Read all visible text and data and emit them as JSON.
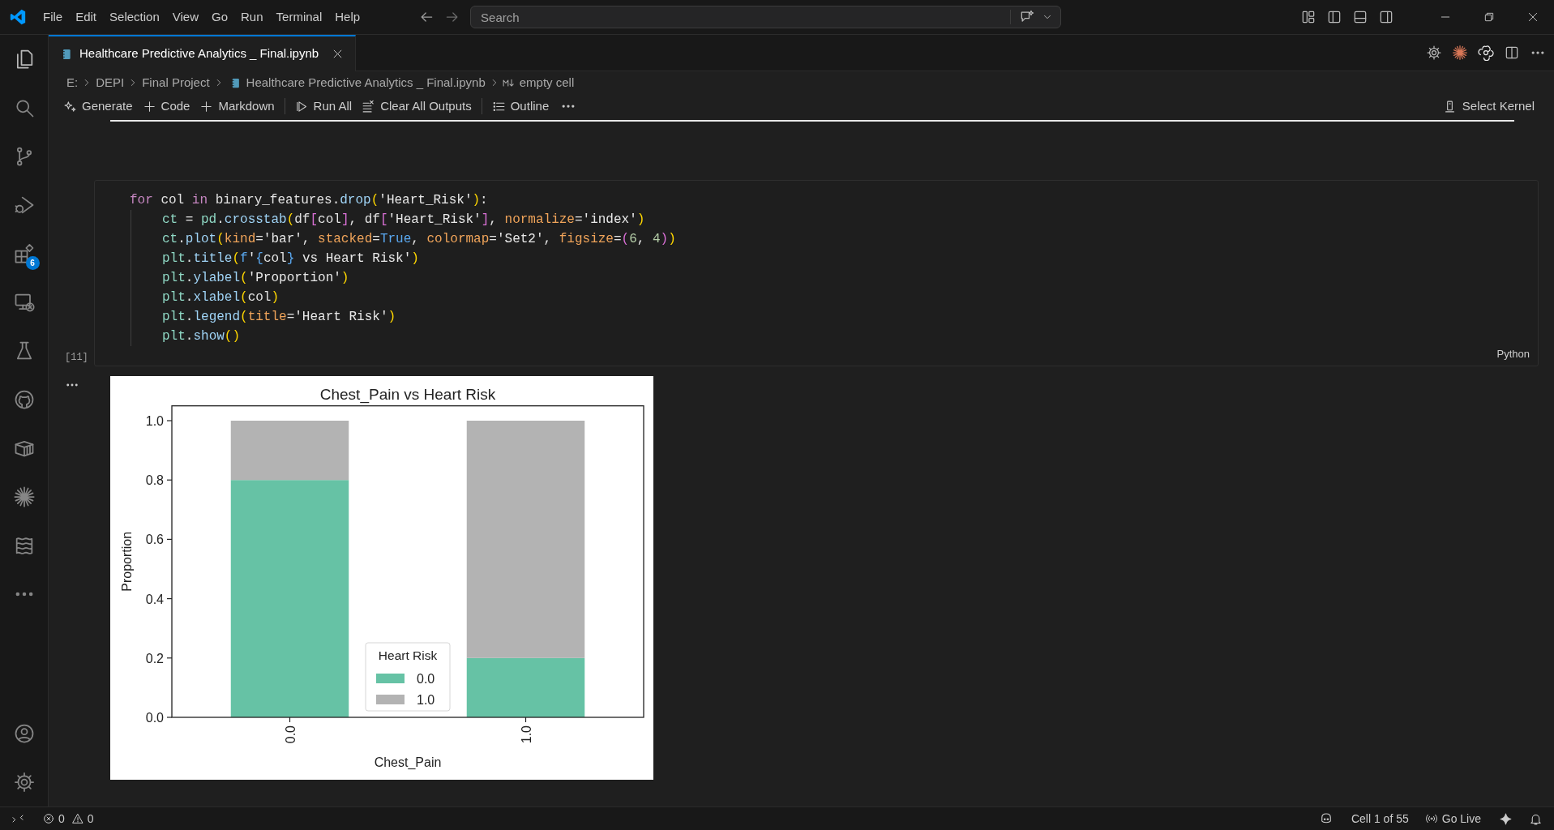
{
  "title_bar": {
    "menus": [
      "File",
      "Edit",
      "Selection",
      "View",
      "Go",
      "Run",
      "Terminal",
      "Help"
    ],
    "search": {
      "placeholder": "Search"
    }
  },
  "activity_bar": {
    "items": [
      {
        "kind": "files"
      },
      {
        "kind": "search"
      },
      {
        "kind": "branch"
      },
      {
        "kind": "debug"
      },
      {
        "kind": "extensions",
        "badge": "6"
      },
      {
        "kind": "remote"
      },
      {
        "kind": "flask"
      },
      {
        "kind": "github"
      },
      {
        "kind": "box"
      },
      {
        "kind": "burst"
      },
      {
        "kind": "waves"
      },
      {
        "kind": "more"
      }
    ],
    "bottom": [
      {
        "kind": "account"
      },
      {
        "kind": "gear"
      }
    ]
  },
  "tab": {
    "title": "Healthcare Predictive Analytics _ Final.ipynb"
  },
  "breadcrumb": [
    {
      "kind": "folder",
      "label": "E:"
    },
    {
      "kind": "folder",
      "label": "DEPI"
    },
    {
      "kind": "folder",
      "label": "Final Project"
    },
    {
      "kind": "notebook",
      "label": "Healthcare Predictive Analytics _ Final.ipynb"
    },
    {
      "kind": "markdown",
      "label": "empty cell"
    }
  ],
  "toolbar": {
    "items": [
      {
        "kind": "sparkle",
        "label": "Generate"
      },
      {
        "kind": "plus",
        "label": "Code"
      },
      {
        "kind": "plus",
        "label": "Markdown"
      },
      {
        "kind": "divider"
      },
      {
        "kind": "play",
        "label": "Run All"
      },
      {
        "kind": "clear",
        "label": "Clear All Outputs"
      },
      {
        "kind": "divider"
      },
      {
        "kind": "list",
        "label": "Outline"
      },
      {
        "kind": "more"
      }
    ],
    "kernel": "Select Kernel"
  },
  "cell": {
    "execution_count": "[11]",
    "language": "Python",
    "code": [
      {
        "tokens": [
          {
            "text": "for",
            "kind": "kw"
          },
          {
            "text": " col ",
            "kind": "var"
          },
          {
            "text": "in",
            "kind": "kw"
          },
          {
            "text": " binary_features.",
            "kind": "var"
          },
          {
            "text": "drop",
            "kind": "fn"
          },
          {
            "text": "(",
            "kind": "b1"
          },
          {
            "text": "'Heart_Risk'",
            "kind": "str"
          },
          {
            "text": ")",
            "kind": "b1"
          },
          {
            "text": ":",
            "kind": "var"
          }
        ],
        "children": [
          {
            "tokens": [
              {
                "text": "ct",
                "kind": "mod"
              },
              {
                "text": " = ",
                "kind": "var"
              },
              {
                "text": "pd",
                "kind": "mod"
              },
              {
                "text": ".",
                "kind": "var"
              },
              {
                "text": "crosstab",
                "kind": "fn"
              },
              {
                "text": "(",
                "kind": "b1"
              },
              {
                "text": "df",
                "kind": "var"
              },
              {
                "text": "[",
                "kind": "b2"
              },
              {
                "text": "col",
                "kind": "var"
              },
              {
                "text": "]",
                "kind": "b2"
              },
              {
                "text": ", df",
                "kind": "var"
              },
              {
                "text": "[",
                "kind": "b2"
              },
              {
                "text": "'Heart_Risk'",
                "kind": "str"
              },
              {
                "text": "]",
                "kind": "b2"
              },
              {
                "text": ", ",
                "kind": "var"
              },
              {
                "text": "normalize",
                "kind": "param"
              },
              {
                "text": "=",
                "kind": "var"
              },
              {
                "text": "'index'",
                "kind": "str"
              },
              {
                "text": ")",
                "kind": "b1"
              }
            ]
          },
          {
            "tokens": [
              {
                "text": "ct",
                "kind": "mod"
              },
              {
                "text": ".",
                "kind": "var"
              },
              {
                "text": "plot",
                "kind": "fn"
              },
              {
                "text": "(",
                "kind": "b1"
              },
              {
                "text": "kind",
                "kind": "param"
              },
              {
                "text": "=",
                "kind": "var"
              },
              {
                "text": "'bar'",
                "kind": "str"
              },
              {
                "text": ", ",
                "kind": "var"
              },
              {
                "text": "stacked",
                "kind": "param"
              },
              {
                "text": "=",
                "kind": "var"
              },
              {
                "text": "True",
                "kind": "const"
              },
              {
                "text": ", ",
                "kind": "var"
              },
              {
                "text": "colormap",
                "kind": "param"
              },
              {
                "text": "=",
                "kind": "var"
              },
              {
                "text": "'Set2'",
                "kind": "str"
              },
              {
                "text": ", ",
                "kind": "var"
              },
              {
                "text": "figsize",
                "kind": "param"
              },
              {
                "text": "=",
                "kind": "var"
              },
              {
                "text": "(",
                "kind": "b2"
              },
              {
                "text": "6",
                "kind": "num"
              },
              {
                "text": ", ",
                "kind": "var"
              },
              {
                "text": "4",
                "kind": "num"
              },
              {
                "text": ")",
                "kind": "b2"
              },
              {
                "text": ")",
                "kind": "b1"
              }
            ]
          },
          {
            "tokens": [
              {
                "text": "plt",
                "kind": "mod"
              },
              {
                "text": ".",
                "kind": "var"
              },
              {
                "text": "title",
                "kind": "fn"
              },
              {
                "text": "(",
                "kind": "b1"
              },
              {
                "text": "f",
                "kind": "const"
              },
              {
                "text": "'",
                "kind": "str"
              },
              {
                "text": "{",
                "kind": "const"
              },
              {
                "text": "col",
                "kind": "var"
              },
              {
                "text": "}",
                "kind": "const"
              },
              {
                "text": " vs Heart Risk'",
                "kind": "str"
              },
              {
                "text": ")",
                "kind": "b1"
              }
            ]
          },
          {
            "tokens": [
              {
                "text": "plt",
                "kind": "mod"
              },
              {
                "text": ".",
                "kind": "var"
              },
              {
                "text": "ylabel",
                "kind": "fn"
              },
              {
                "text": "(",
                "kind": "b1"
              },
              {
                "text": "'Proportion'",
                "kind": "str"
              },
              {
                "text": ")",
                "kind": "b1"
              }
            ]
          },
          {
            "tokens": [
              {
                "text": "plt",
                "kind": "mod"
              },
              {
                "text": ".",
                "kind": "var"
              },
              {
                "text": "xlabel",
                "kind": "fn"
              },
              {
                "text": "(",
                "kind": "b1"
              },
              {
                "text": "col",
                "kind": "var"
              },
              {
                "text": ")",
                "kind": "b1"
              }
            ]
          },
          {
            "tokens": [
              {
                "text": "plt",
                "kind": "mod"
              },
              {
                "text": ".",
                "kind": "var"
              },
              {
                "text": "legend",
                "kind": "fn"
              },
              {
                "text": "(",
                "kind": "b1"
              },
              {
                "text": "title",
                "kind": "param"
              },
              {
                "text": "=",
                "kind": "var"
              },
              {
                "text": "'Heart Risk'",
                "kind": "str"
              },
              {
                "text": ")",
                "kind": "b1"
              }
            ]
          },
          {
            "tokens": [
              {
                "text": "plt",
                "kind": "mod"
              },
              {
                "text": ".",
                "kind": "var"
              },
              {
                "text": "show",
                "kind": "fn"
              },
              {
                "text": "()",
                "kind": "b1"
              }
            ]
          }
        ]
      }
    ]
  },
  "output": {
    "chart_data": {
      "type": "bar",
      "title": "Chest_Pain vs Heart Risk",
      "xlabel": "Chest_Pain",
      "ylabel": "Proportion",
      "categories": [
        "0.0",
        "1.0"
      ],
      "stacked": true,
      "ylim": [
        0,
        1.05
      ],
      "yticks": [
        {
          "value": 0,
          "label": "0.0"
        },
        {
          "value": 0.2,
          "label": "0.2"
        },
        {
          "value": 0.4,
          "label": "0.4"
        },
        {
          "value": 0.6,
          "label": "0.6"
        },
        {
          "value": 0.8,
          "label": "0.8"
        },
        {
          "value": 1,
          "label": "1.0"
        }
      ],
      "legend": {
        "title": "Heart Risk"
      },
      "series": [
        {
          "name": "0.0",
          "color": "#66c2a5",
          "values": [
            0.8,
            0.2
          ]
        },
        {
          "name": "1.0",
          "color": "#b3b3b3",
          "values": [
            0.2,
            0.8
          ]
        }
      ]
    }
  },
  "status_bar": {
    "errors": "0",
    "warnings": "0",
    "cell_position": "Cell 1 of 55",
    "live": "Go Live"
  }
}
